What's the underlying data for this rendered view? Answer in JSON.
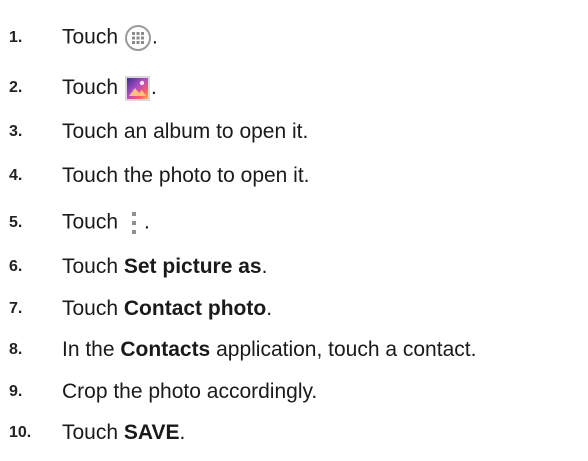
{
  "steps": [
    {
      "number": "1.",
      "pre": "Touch",
      "icon": "apps-grid-icon",
      "post": "."
    },
    {
      "number": "2.",
      "pre": "Touch",
      "icon": "gallery-icon",
      "post": "."
    },
    {
      "number": "3.",
      "text": "Touch an album to open it."
    },
    {
      "number": "4.",
      "text": "Touch the photo to open it."
    },
    {
      "number": "5.",
      "pre": "Touch",
      "icon": "overflow-menu-icon",
      "post": "."
    },
    {
      "number": "6.",
      "pre": "Touch ",
      "bold": "Set picture as",
      "post": "."
    },
    {
      "number": "7.",
      "pre": "Touch ",
      "bold": "Contact photo",
      "post": "."
    },
    {
      "number": "8.",
      "pre": "In the ",
      "bold": "Contacts",
      "post": " application, touch a contact."
    },
    {
      "number": "9.",
      "text": "Crop the photo accordingly."
    },
    {
      "number": "10.",
      "pre": "Touch ",
      "bold": "SAVE",
      "post": "."
    }
  ],
  "colors": {
    "text": "#1a1a1a",
    "icon_gray": "#9a9a9a"
  }
}
